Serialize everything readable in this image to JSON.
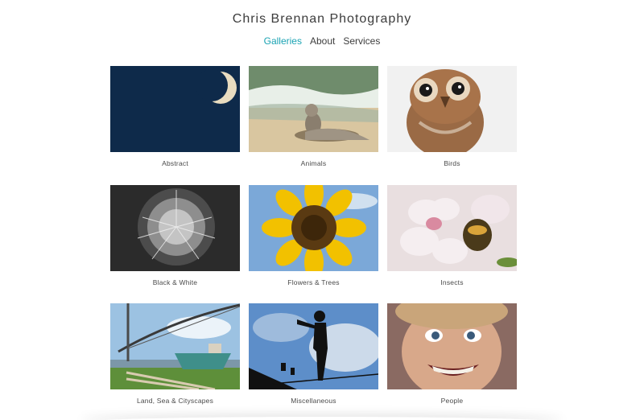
{
  "site": {
    "title": "Chris Brennan Photography"
  },
  "nav": {
    "items": [
      {
        "label": "Galleries",
        "active": true
      },
      {
        "label": "About",
        "active": false
      },
      {
        "label": "Services",
        "active": false
      }
    ],
    "active_color": "#1aa3b3"
  },
  "galleries": [
    {
      "caption": "Abstract",
      "image": "moon-photo"
    },
    {
      "caption": "Animals",
      "image": "seal-on-beach-photo"
    },
    {
      "caption": "Birds",
      "image": "owl-photo"
    },
    {
      "caption": "Black & White",
      "image": "dandelion-photo"
    },
    {
      "caption": "Flowers & Trees",
      "image": "sunflower-photo"
    },
    {
      "caption": "Insects",
      "image": "bee-on-blossom-photo"
    },
    {
      "caption": "Land, Sea & Cityscapes",
      "image": "bridge-and-boat-photo"
    },
    {
      "caption": "Miscellaneous",
      "image": "tightrope-silhouette-photo"
    },
    {
      "caption": "People",
      "image": "smiling-child-photo"
    }
  ]
}
